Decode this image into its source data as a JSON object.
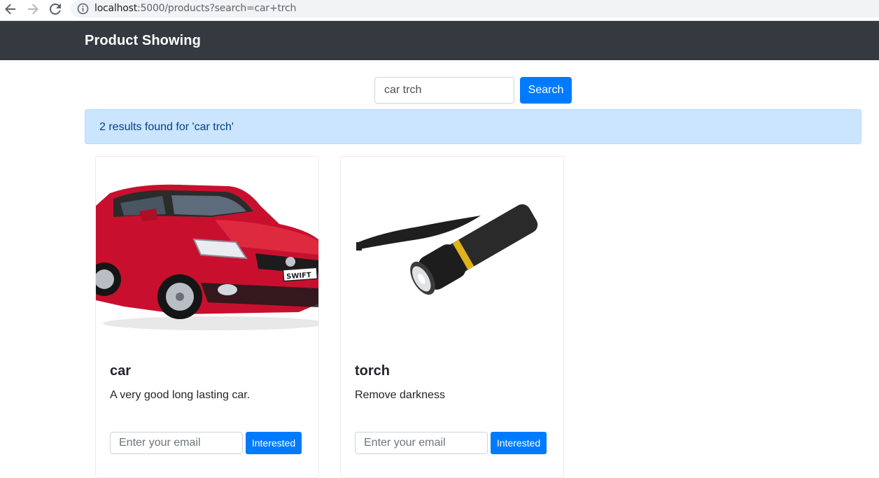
{
  "browser": {
    "url_host": "localhost",
    "url_rest": ":5000/products?search=car+trch",
    "icons": {
      "back": "arrow-left-icon",
      "forward": "arrow-right-icon",
      "reload": "reload-icon",
      "info": "info-icon"
    }
  },
  "navbar": {
    "brand": "Product Showing",
    "background": "#343a40"
  },
  "search": {
    "value": "car trch",
    "button_label": "Search",
    "accent": "#007bff"
  },
  "alert": {
    "message": "2 results found for 'car trch'",
    "background": "#cce5ff",
    "text_color": "#004085"
  },
  "products": [
    {
      "title": "car",
      "description": "A very good long lasting car.",
      "image": "red-hatchback-car",
      "email_placeholder": "Enter your email",
      "button_label": "Interested"
    },
    {
      "title": "torch",
      "description": "Remove darkness",
      "image": "black-flashlight",
      "email_placeholder": "Enter your email",
      "button_label": "Interested"
    }
  ]
}
